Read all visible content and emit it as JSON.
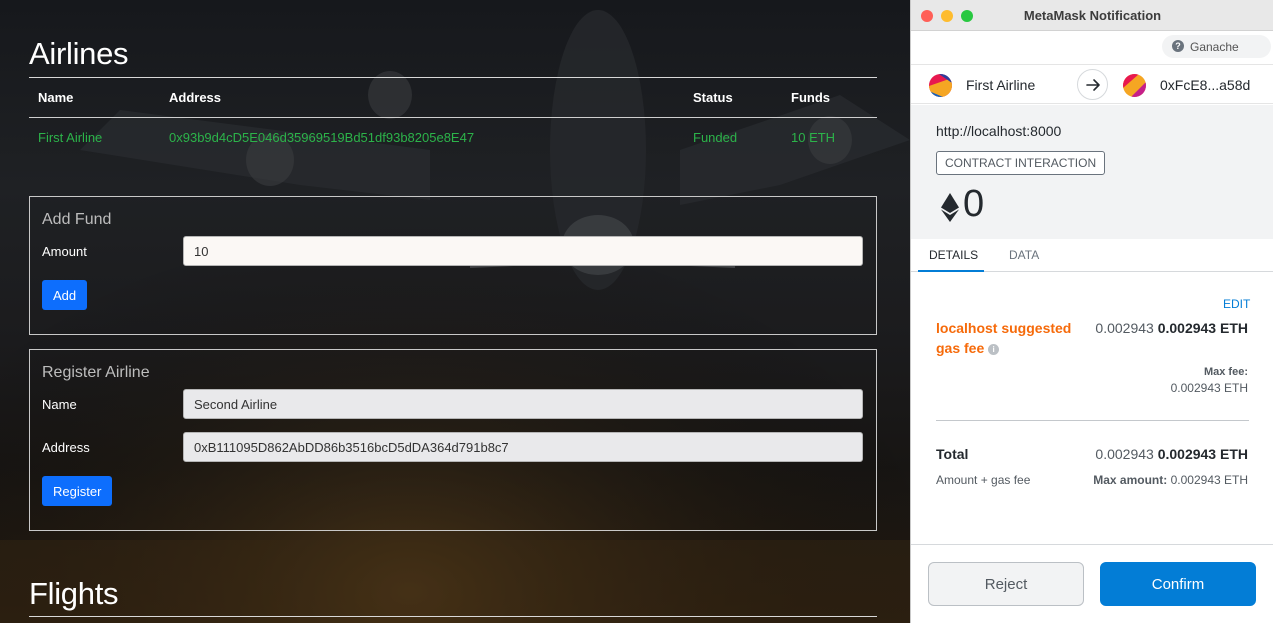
{
  "dapp": {
    "airlines": {
      "title": "Airlines",
      "columns": [
        "Name",
        "Address",
        "Status",
        "Funds"
      ],
      "rows": [
        {
          "name": "First Airline",
          "address": "0x93b9d4cD5E046d35969519Bd51df93b8205e8E47",
          "status": "Funded",
          "funds": "10 ETH"
        }
      ]
    },
    "add_fund": {
      "title": "Add Fund",
      "amount_label": "Amount",
      "amount_value": "10",
      "button": "Add"
    },
    "register_airline": {
      "title": "Register Airline",
      "name_label": "Name",
      "name_value": "Second Airline",
      "address_label": "Address",
      "address_value": "0xB111095D862AbDD86b3516bcD5dDA364d791b8c7",
      "button": "Register"
    },
    "flights": {
      "title": "Flights"
    },
    "colors": {
      "funded_green": "#2cb34a",
      "button_blue": "#0d6efd"
    }
  },
  "metamask": {
    "window_title": "MetaMask Notification",
    "network": "Ganache",
    "from_account": "First Airline",
    "to_account": "0xFcE8...a58d",
    "origin": "http://localhost:8000",
    "badge": "CONTRACT INTERACTION",
    "amount": "0",
    "tabs": [
      "DETAILS",
      "DATA"
    ],
    "active_tab": "DETAILS",
    "edit": "EDIT",
    "gas_label": "localhost suggested gas fee",
    "gas_value_plain": "0.002943",
    "gas_value_bold": "0.002943 ETH",
    "max_fee_label": "Max fee:",
    "max_fee_value": "0.002943 ETH",
    "total_label": "Total",
    "total_value_plain": "0.002943",
    "total_value_bold": "0.002943 ETH",
    "total_sub_label": "Amount + gas fee",
    "max_amount_label": "Max amount:",
    "max_amount_value": "0.002943 ETH",
    "reject": "Reject",
    "confirm": "Confirm",
    "colors": {
      "accent_blue": "#037dd6",
      "gas_orange": "#f66a0a"
    }
  }
}
